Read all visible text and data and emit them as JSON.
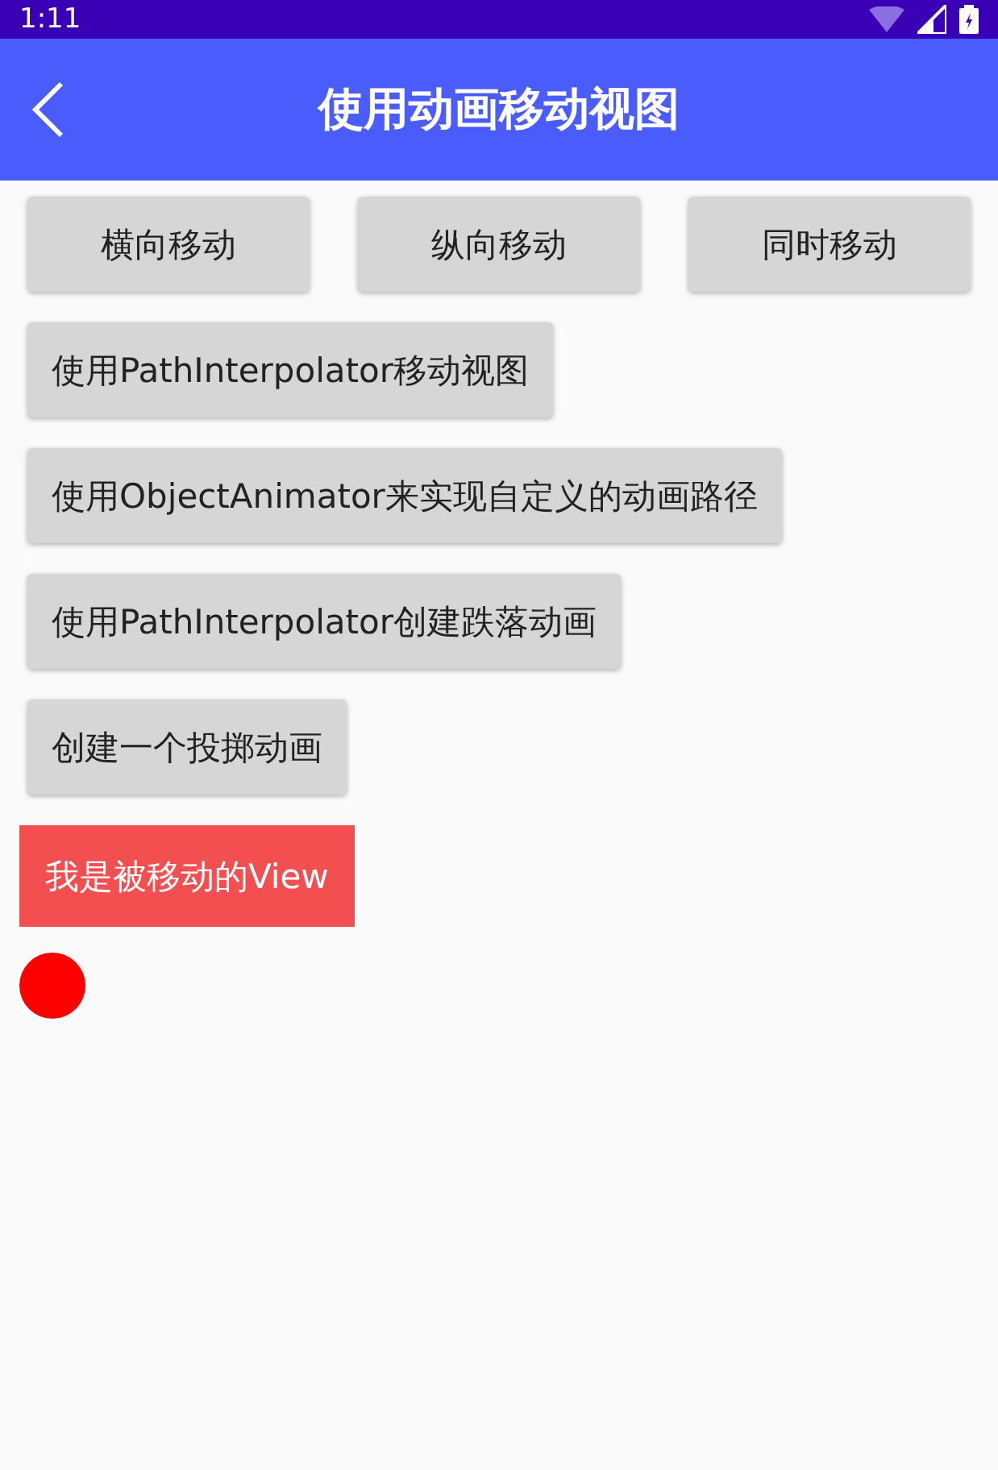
{
  "status_bar": {
    "time": "1:11"
  },
  "app_bar": {
    "title": "使用动画移动视图"
  },
  "button_row": [
    "横向移动",
    "纵向移动",
    "同时移动"
  ],
  "buttons": [
    "使用PathInterpolator移动视图",
    "使用ObjectAnimator来实现自定义的动画路径",
    "使用PathInterpolator创建跌落动画",
    "创建一个投掷动画"
  ],
  "moved_view": {
    "label": "我是被移动的View"
  }
}
